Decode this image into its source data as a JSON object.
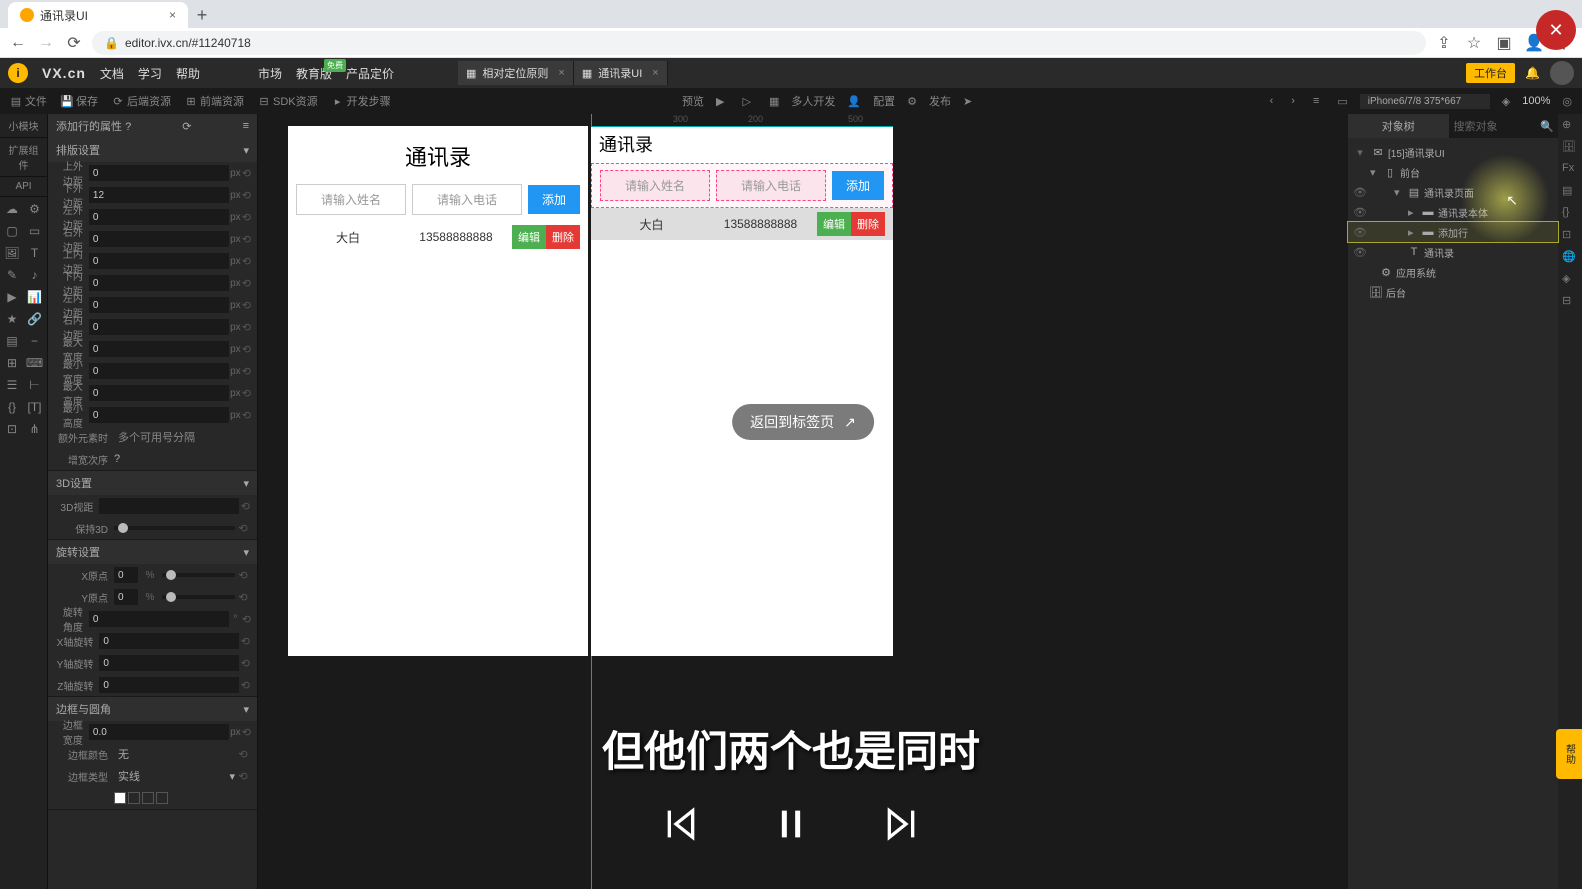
{
  "browser": {
    "tab_title": "通讯录UI",
    "url": "editor.ivx.cn/#11240718"
  },
  "app": {
    "logo_text": "VX.cn",
    "menu": {
      "docs": "文档",
      "learn": "学习",
      "help": "帮助",
      "market": "市场",
      "edu": "教育版",
      "edu_badge": "免费",
      "pricing": "产品定价"
    },
    "tabs": [
      {
        "label": "相对定位原则"
      },
      {
        "label": "通讯录UI"
      }
    ],
    "work_btn": "工作台"
  },
  "toolbar": {
    "file": "文件",
    "save": "保存",
    "backend": "后端资源",
    "frontend": "前端资源",
    "sdk": "SDK资源",
    "steps": "开发步骤",
    "preview": "预览",
    "multidev": "多人开发",
    "config": "配置",
    "publish": "发布",
    "device": "iPhone6/7/8 375*667",
    "zoom": "100%"
  },
  "props": {
    "title": "添加行的属性",
    "sections": {
      "layout": "排版设置",
      "three_d": "3D设置",
      "rotate": "旋转设置",
      "border": "边框与圆角"
    },
    "labels": {
      "margin_t": "上外边距",
      "margin_b": "下外边距",
      "margin_l": "左外边距",
      "margin_r": "右外边距",
      "padding_t": "上内边距",
      "padding_b": "下内边距",
      "padding_l": "左内边距",
      "padding_r": "右内边距",
      "max_w": "最大宽度",
      "min_w": "最小宽度",
      "max_h": "最大高度",
      "min_h": "最小高度",
      "extra": "额外元素时",
      "extra_val": "多个可用号分隔",
      "repeat": "增宽次序",
      "angle3d": "3D视距",
      "keep3d": "保持3D",
      "rotate_x": "X原点",
      "rotate_y": "Y原点",
      "rot_angle": "旋转角度",
      "rot_x": "X轴旋转",
      "rot_y": "Y轴旋转",
      "rot_z": "Z轴旋转",
      "border_w": "边框宽度",
      "border_c": "边框颜色",
      "border_s": "边框类型"
    },
    "values": {
      "margin_t": "0",
      "margin_b": "12",
      "margin_l": "0",
      "margin_r": "0",
      "padding_t": "0",
      "padding_b": "0",
      "padding_l": "0",
      "padding_r": "0",
      "max_w": "0",
      "min_w": "0",
      "max_h": "0",
      "min_h": "0",
      "rotate_x": "0",
      "rotate_y": "0",
      "rot_angle": "0",
      "rot_x": "0",
      "rot_y": "0",
      "rot_z": "0",
      "border_w": "0.0",
      "border_c": "无",
      "border_s": "实线",
      "unit_px": "px",
      "unit_pct": "%"
    }
  },
  "left_cats": {
    "small": "小模块",
    "ext": "扩展组件",
    "api": "API"
  },
  "phone": {
    "title": "通讯录",
    "name_ph": "请输入姓名",
    "phone_ph": "请输入电话",
    "add": "添加",
    "row_name": "大白",
    "row_phone": "13588888888",
    "edit": "编辑",
    "delete": "删除",
    "return_btn": "返回到标签页"
  },
  "ruler": {
    "n300": "300",
    "n200": "200",
    "n500": "500"
  },
  "tree": {
    "tab_objects": "对象树",
    "search_ph": "搜索对象",
    "root": "[15]通讯录UI",
    "n1": "前台",
    "n2": "通讯录页面",
    "n3": "通讯录本体",
    "n4": "添加行",
    "n5": "通讯录",
    "n6": "应用系统",
    "n7": "后台"
  },
  "subtitle": "但他们两个也是同时",
  "help_tag": "帮助"
}
